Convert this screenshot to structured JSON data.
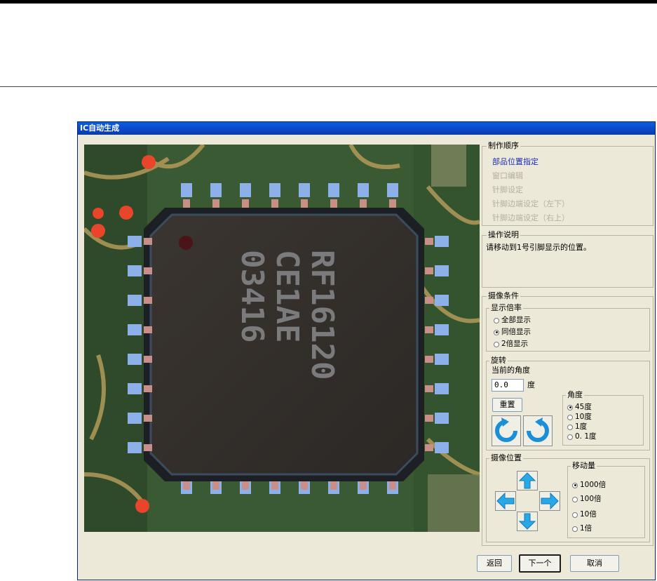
{
  "window": {
    "title": "IC自动生成"
  },
  "procedure": {
    "legend": "制作顺序",
    "steps": [
      {
        "label": "部品位置指定",
        "state": "active"
      },
      {
        "label": "窗口编辑",
        "state": "disabled"
      },
      {
        "label": "针脚设定",
        "state": "disabled"
      },
      {
        "label": "针脚边端设定（左下）",
        "state": "disabled"
      },
      {
        "label": "针脚边端设定（右上）",
        "state": "disabled"
      }
    ]
  },
  "instructions": {
    "legend": "操作说明",
    "text": "请移动到1号引脚显示的位置。"
  },
  "camera": {
    "legend": "摄像条件",
    "display_zoom": {
      "legend": "显示倍率",
      "options": [
        "全部显示",
        "同倍显示",
        "2倍显示"
      ],
      "selected": "同倍显示"
    },
    "rotation": {
      "legend": "旋转",
      "current_label": "当前的角度",
      "current_value": "0.0",
      "unit": "度",
      "reset_label": "重置",
      "rotate_ccw_icon": "rotate-ccw-icon",
      "rotate_cw_icon": "rotate-cw-icon",
      "angle": {
        "legend": "角度",
        "options": [
          "45度",
          "10度",
          "1度",
          "0. 1度"
        ],
        "selected": "45度"
      }
    },
    "position": {
      "legend": "摄像位置",
      "move": {
        "legend": "移动量",
        "options": [
          "1000倍",
          "100倍",
          "10倍",
          "1倍"
        ],
        "selected": "1000倍"
      }
    }
  },
  "footer": {
    "back_label": "返回",
    "next_label": "下一个",
    "cancel_label": "取消"
  },
  "preview": {
    "chip_text_lines": [
      "RF16120",
      "CE1AE",
      "03416"
    ]
  },
  "colors": {
    "accent": "#1a2cc4",
    "arrow": "#29a8e8"
  }
}
